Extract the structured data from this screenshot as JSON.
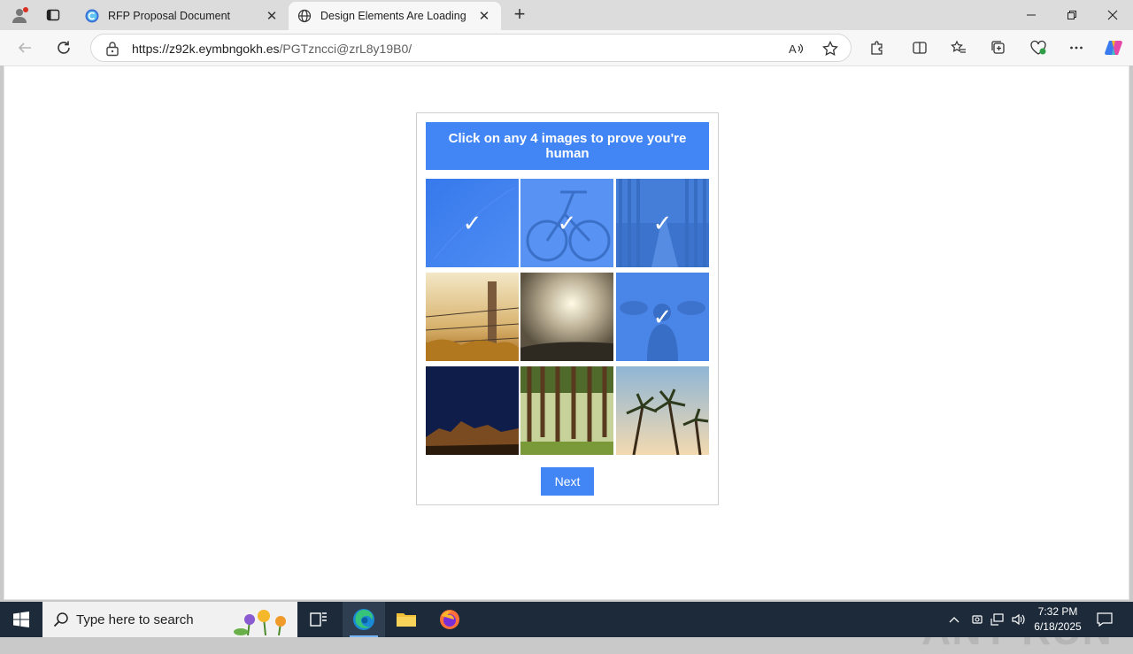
{
  "browser": {
    "tabs": [
      {
        "title": "RFP Proposal Document",
        "icon": "c-logo-icon"
      },
      {
        "title": "Design Elements Are Loading",
        "icon": "globe-icon"
      }
    ],
    "url_host": "https://z92k.eymbngokh.es",
    "url_path": "/PGTzncci@zrL8y19B0/"
  },
  "captcha": {
    "instruction": "Click on any 4 images to prove you're human",
    "next_label": "Next",
    "accent": "#4285f4",
    "tiles": [
      {
        "subject": "blue sky",
        "selected": true
      },
      {
        "subject": "bicycle",
        "selected": true
      },
      {
        "subject": "forest road",
        "selected": true
      },
      {
        "subject": "fence post",
        "selected": false
      },
      {
        "subject": "cloudy sky",
        "selected": false
      },
      {
        "subject": "man with camera",
        "selected": true
      },
      {
        "subject": "night sky",
        "selected": false
      },
      {
        "subject": "pine forest",
        "selected": false
      },
      {
        "subject": "palm trees",
        "selected": false
      }
    ]
  },
  "watermark": "ANY RUN",
  "taskbar": {
    "search_placeholder": "Type here to search",
    "time": "7:32 PM",
    "date": "6/18/2025"
  }
}
